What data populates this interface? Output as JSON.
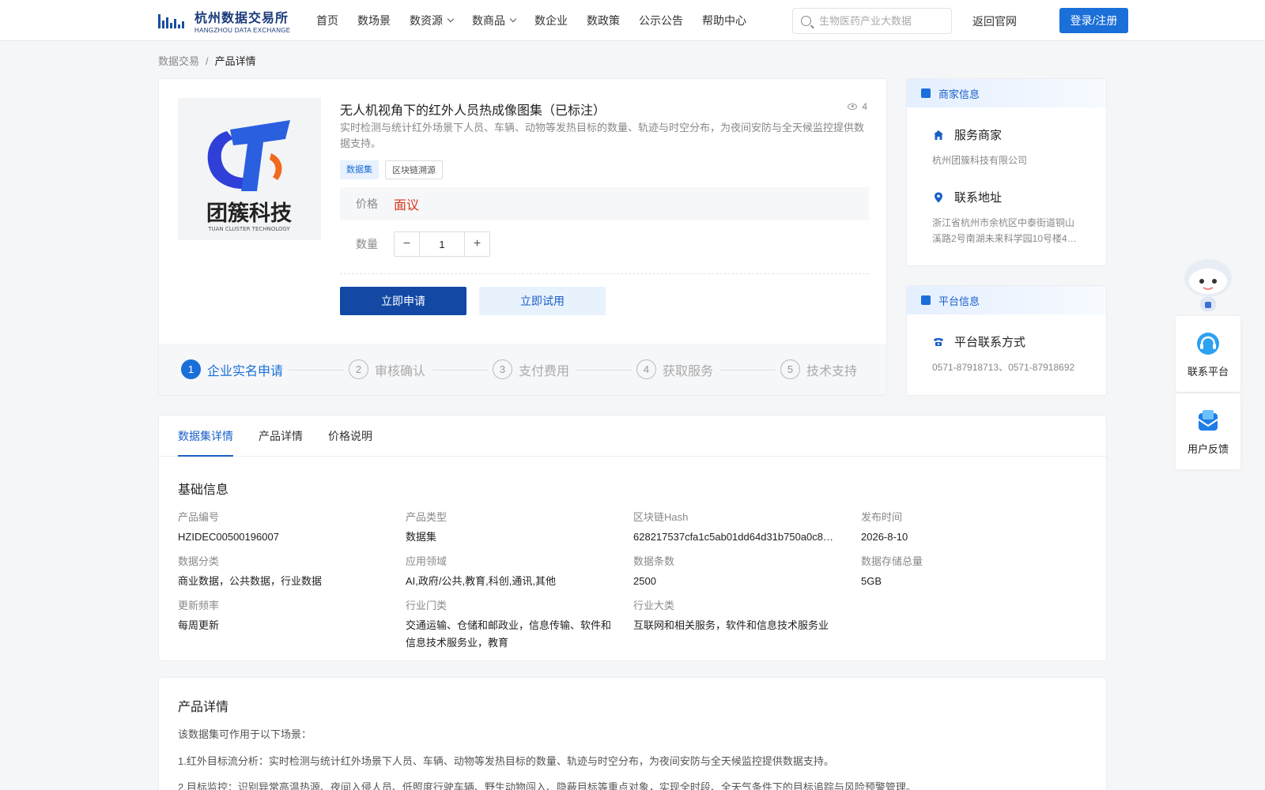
{
  "header": {
    "logo_cn": "杭州数据交易所",
    "logo_en": "HANGZHOU DATA EXCHANGE",
    "nav": [
      {
        "label": "首页",
        "dropdown": false
      },
      {
        "label": "数场景",
        "dropdown": false
      },
      {
        "label": "数资源",
        "dropdown": true
      },
      {
        "label": "数商品",
        "dropdown": true
      },
      {
        "label": "数企业",
        "dropdown": false
      },
      {
        "label": "数政策",
        "dropdown": false
      },
      {
        "label": "公示公告",
        "dropdown": false
      },
      {
        "label": "帮助中心",
        "dropdown": false
      }
    ],
    "search_placeholder": "生物医药产业大数据",
    "back_label": "返回官网",
    "login_label": "登录/注册"
  },
  "breadcrumb": {
    "parent": "数据交易",
    "current": "产品详情"
  },
  "product": {
    "logo_cn": "团簇科技",
    "logo_en": "TUAN CLUSTER TECHNOLOGY",
    "title": "无人机视角下的红外人员热成像图集（已标注）",
    "views": "4",
    "description": "实时检测与统计红外场景下人员、车辆、动物等发热目标的数量、轨迹与时空分布，为夜间安防与全天候监控提供数据支持。",
    "tags": [
      "数据集",
      "区块链溯源"
    ],
    "price_label": "价格",
    "price_value": "面议",
    "qty_label": "数量",
    "qty_value": "1",
    "apply_label": "立即申请",
    "trial_label": "立即试用",
    "steps": [
      {
        "num": "1",
        "label": "企业实名申请"
      },
      {
        "num": "2",
        "label": "审核确认"
      },
      {
        "num": "3",
        "label": "支付费用"
      },
      {
        "num": "4",
        "label": "获取服务"
      },
      {
        "num": "5",
        "label": "技术支持"
      }
    ]
  },
  "merchant": {
    "head": "商家信息",
    "service_title": "服务商家",
    "service_value": "杭州团簇科技有限公司",
    "address_title": "联系地址",
    "address_value": "浙江省杭州市余杭区中泰街道铜山溪路2号南湖未来科学园10号楼4…"
  },
  "platform": {
    "head": "平台信息",
    "contact_title": "平台联系方式",
    "contact_value": "0571-87918713、0571-87918692"
  },
  "float": {
    "contact": "联系平台",
    "feedback": "用户反馈"
  },
  "tabs": [
    {
      "label": "数据集详情",
      "active": true
    },
    {
      "label": "产品详情",
      "active": false
    },
    {
      "label": "价格说明",
      "active": false
    }
  ],
  "basic": {
    "title": "基础信息",
    "fields": [
      {
        "k": "产品编号",
        "v": "HZIDEC00500196007"
      },
      {
        "k": "产品类型",
        "v": "数据集"
      },
      {
        "k": "区块链Hash",
        "v": "628217537cfa1c5ab01dd64d31b750a0c8…"
      },
      {
        "k": "发布时间",
        "v": "2026-8-10"
      },
      {
        "k": "数据分类",
        "v": "商业数据，公共数据，行业数据"
      },
      {
        "k": "应用领域",
        "v": "AI,政府/公共,教育,科创,通讯,其他"
      },
      {
        "k": "数据条数",
        "v": "2500"
      },
      {
        "k": "数据存储总量",
        "v": "5GB"
      },
      {
        "k": "更新频率",
        "v": "每周更新"
      },
      {
        "k": "行业门类",
        "v": "交通运输、仓储和邮政业，信息传输、软件和信息技术服务业，教育"
      },
      {
        "k": "行业大类",
        "v": "互联网和相关服务，软件和信息技术服务业"
      }
    ]
  },
  "detail": {
    "title": "产品详情",
    "intro": "该数据集可作用于以下场景：",
    "items": [
      "1.红外目标流分析：实时检测与统计红外场景下人员、车辆、动物等发热目标的数量、轨迹与时空分布，为夜间安防与全天候监控提供数据支持。",
      "2.目标监控：识别异常高温热源、夜间入侵人员、低照度行驶车辆、野生动物闯入、隐蔽目标等重点对象，实现全时段、全天气条件下的目标追踪与风险预警管理。"
    ]
  },
  "colors": {
    "brand": "#1a6fd8",
    "primary_btn": "#1349a5",
    "price": "#d9341c"
  }
}
